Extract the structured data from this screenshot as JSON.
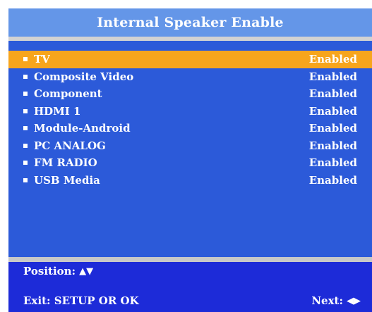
{
  "window": {
    "title": "Internal Speaker Enable"
  },
  "menu": {
    "selected_index": 0,
    "items": [
      {
        "label": "TV",
        "value": "Enabled"
      },
      {
        "label": "Composite Video",
        "value": "Enabled"
      },
      {
        "label": "Component",
        "value": "Enabled"
      },
      {
        "label": "HDMI 1",
        "value": "Enabled"
      },
      {
        "label": "Module-Android",
        "value": "Enabled"
      },
      {
        "label": "PC ANALOG",
        "value": "Enabled"
      },
      {
        "label": "FM RADIO",
        "value": "Enabled"
      },
      {
        "label": "USB Media",
        "value": "Enabled"
      }
    ]
  },
  "footer": {
    "position_label": "Position:",
    "position_arrows": "▲▼",
    "exit_label": "Exit:  SETUP OR OK",
    "next_label": "Next:",
    "next_arrows": "◀▶"
  },
  "colors": {
    "header": "#6496e8",
    "list_background": "#2c5ad9",
    "selected_row": "#f7a51c",
    "footer_background": "#1d2bd8",
    "text": "#ffffff"
  },
  "icons": {
    "bullet": "square-bullet-icon",
    "position": "up-down-arrows-icon",
    "next": "left-right-arrows-icon"
  }
}
